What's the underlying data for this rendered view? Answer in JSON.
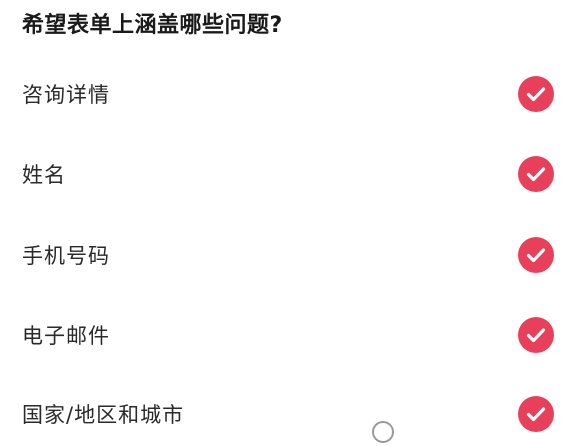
{
  "form": {
    "title": "希望表单上涵盖哪些问题?",
    "options": [
      {
        "label": "咨询详情",
        "checked": true,
        "icon": "check-circle-icon"
      },
      {
        "label": "姓名",
        "checked": true,
        "icon": "check-circle-icon"
      },
      {
        "label": "手机号码",
        "checked": true,
        "icon": "check-circle-icon"
      },
      {
        "label": "电子邮件",
        "checked": true,
        "icon": "check-circle-icon"
      },
      {
        "label": "国家/地区和城市",
        "checked": true,
        "icon": "check-circle-icon"
      }
    ]
  },
  "colors": {
    "accent": "#e8405a",
    "text": "#2a2a2a",
    "background": "#ffffff"
  }
}
